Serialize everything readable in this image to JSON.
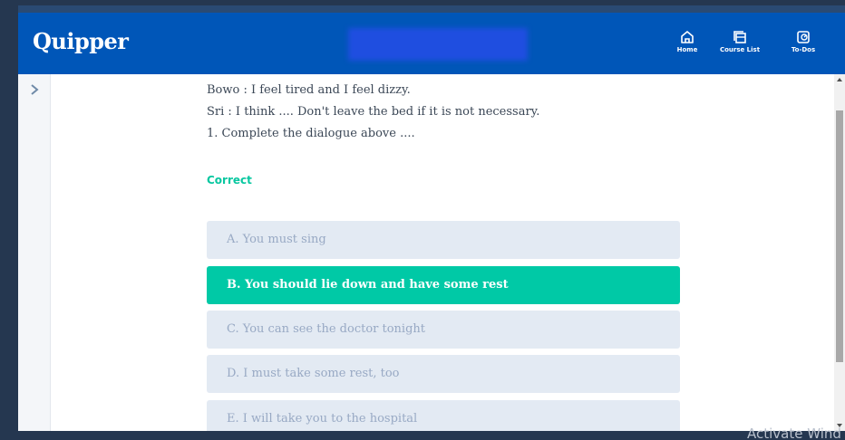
{
  "app": {
    "logo": "Quipper"
  },
  "nav": [
    {
      "label": "Home",
      "icon": "home-icon"
    },
    {
      "label": "Course List",
      "icon": "course-list-icon"
    },
    {
      "label": "To-Dos",
      "icon": "todo-icon"
    }
  ],
  "question": {
    "lines": [
      "Bowo : I feel tired and I feel dizzy.",
      "Sri : I think .... Don't leave the bed if it is not necessary.",
      "1. Complete the dialogue above ...."
    ],
    "result": "Correct"
  },
  "options": [
    {
      "label": "A. You must sing",
      "selected": false
    },
    {
      "label": "B. You should lie down and have some rest",
      "selected": true
    },
    {
      "label": "C. You can see the doctor tonight",
      "selected": false
    },
    {
      "label": "D. I must take some rest, too",
      "selected": false
    },
    {
      "label": "E. I will take you to the hospital",
      "selected": false
    }
  ],
  "watermark": "Activate Wind",
  "colors": {
    "header": "#0056b8",
    "correct": "#08c7a0",
    "selected_option": "#00c9a6",
    "option_bg": "#e3eaf3",
    "option_text": "#98a9c4"
  }
}
